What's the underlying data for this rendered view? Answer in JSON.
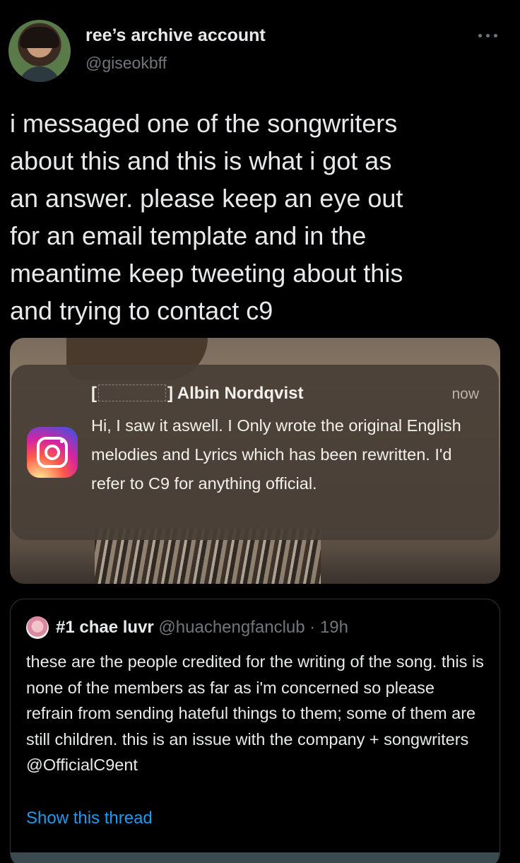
{
  "author": {
    "display_name": "ree’s archive account",
    "handle": "@giseokbff",
    "avatar_icon": "user-avatar"
  },
  "tweet": {
    "text": "i messaged one of the songwriters\nabout this and this is what i got as\nan answer. please keep an eye out\nfor an email template and in the\nmeantime keep tweeting about this\nand trying to contact c9"
  },
  "notification": {
    "app_icon": "instagram-icon",
    "bracket_open": "[",
    "bracket_close": "]",
    "sender": "Albin Nordqvist",
    "time": "now",
    "message": "Hi, I saw it aswell. I Only wrote the original English melodies and Lyrics which has been rewritten. I'd refer to C9 for anything official."
  },
  "quoted_tweet": {
    "display_name": "#1 chae luvr",
    "handle": "@huachengfanclub",
    "separator": " · ",
    "time": "19h",
    "text": "these are the people credited for the writing of the song. this is none of the members as far as i'm concerned so please refrain from sending hateful things to them; some of them are still children. this is an issue with the company + songwriters @OfficialC9ent",
    "show_thread": "Show this thread"
  },
  "colors": {
    "background": "#000000",
    "text": "#e7e9ea",
    "muted": "#71767b",
    "link": "#1d9bf0"
  }
}
